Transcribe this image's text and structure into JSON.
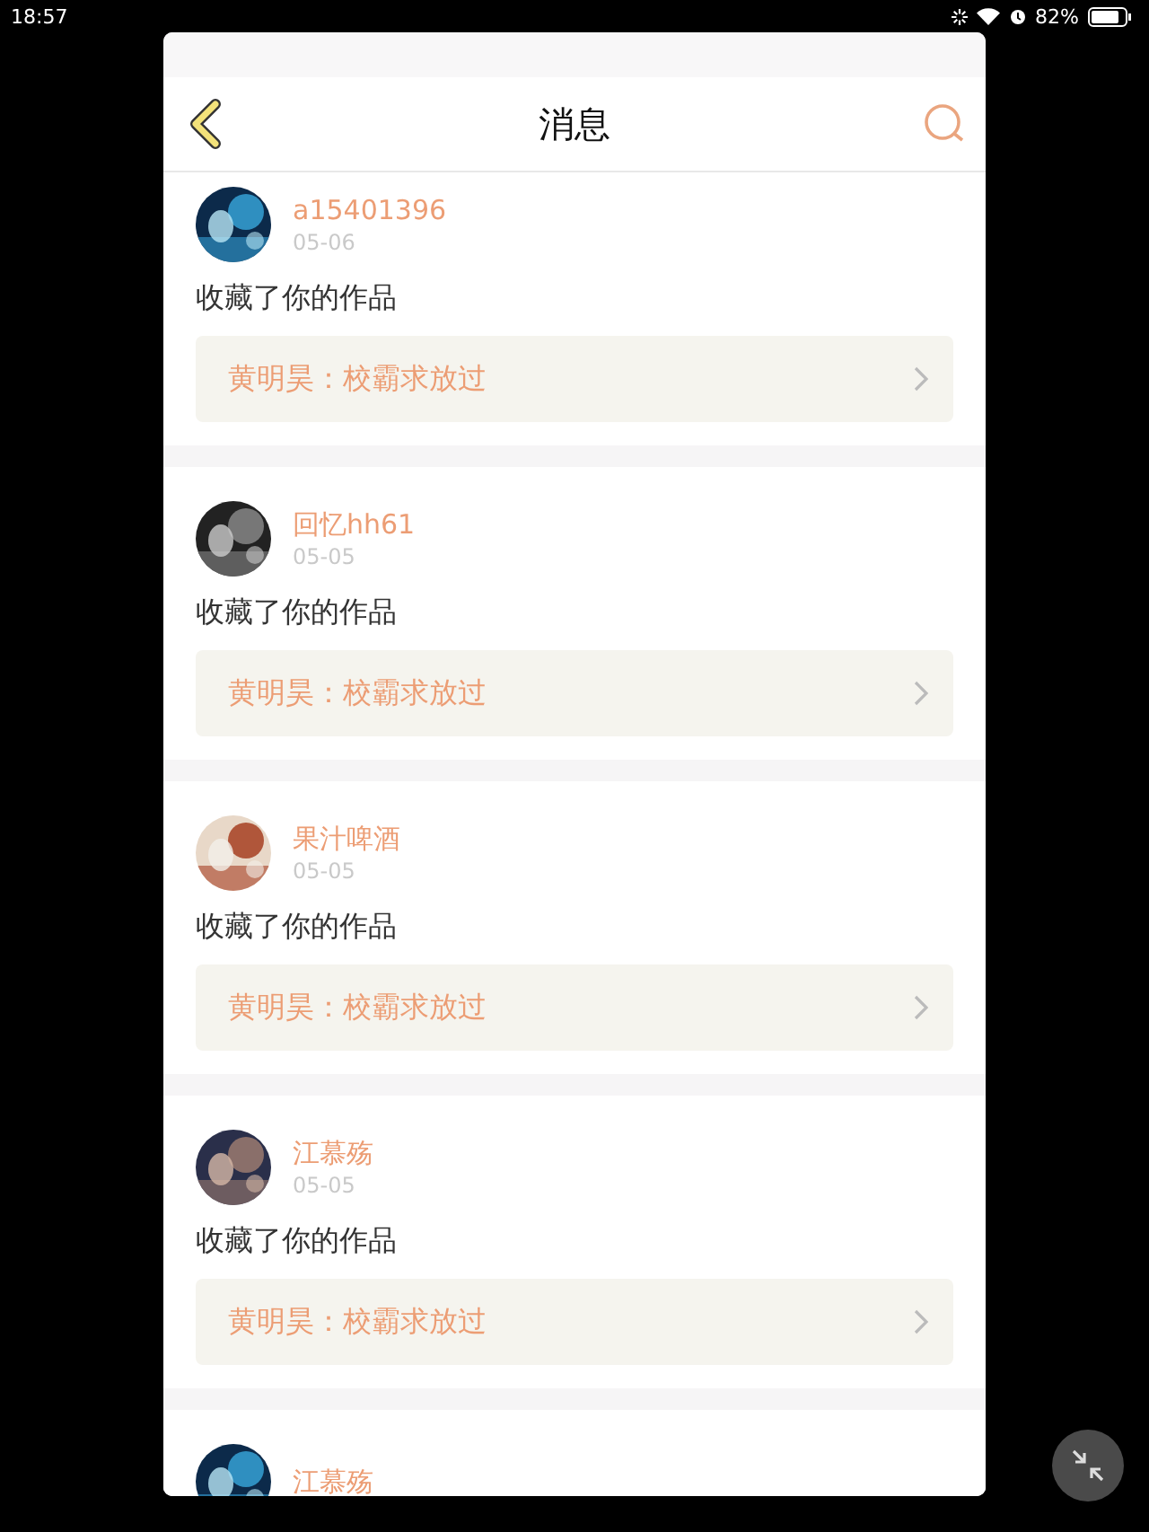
{
  "status_bar": {
    "time": "18:57",
    "battery": "82%"
  },
  "header": {
    "title": "消息"
  },
  "messages": [
    {
      "user": "a15401396",
      "date": "05-06",
      "action": "收藏了你的作品",
      "quote": "黄明昊：校霸求放过"
    },
    {
      "user": "回忆hh61",
      "date": "05-05",
      "action": "收藏了你的作品",
      "quote": "黄明昊：校霸求放过"
    },
    {
      "user": "果汁啤酒",
      "date": "05-05",
      "action": "收藏了你的作品",
      "quote": "黄明昊：校霸求放过"
    },
    {
      "user": "江慕殇",
      "date": "05-05",
      "action": "收藏了你的作品",
      "quote": "黄明昊：校霸求放过"
    },
    {
      "user": "江慕殇"
    }
  ]
}
